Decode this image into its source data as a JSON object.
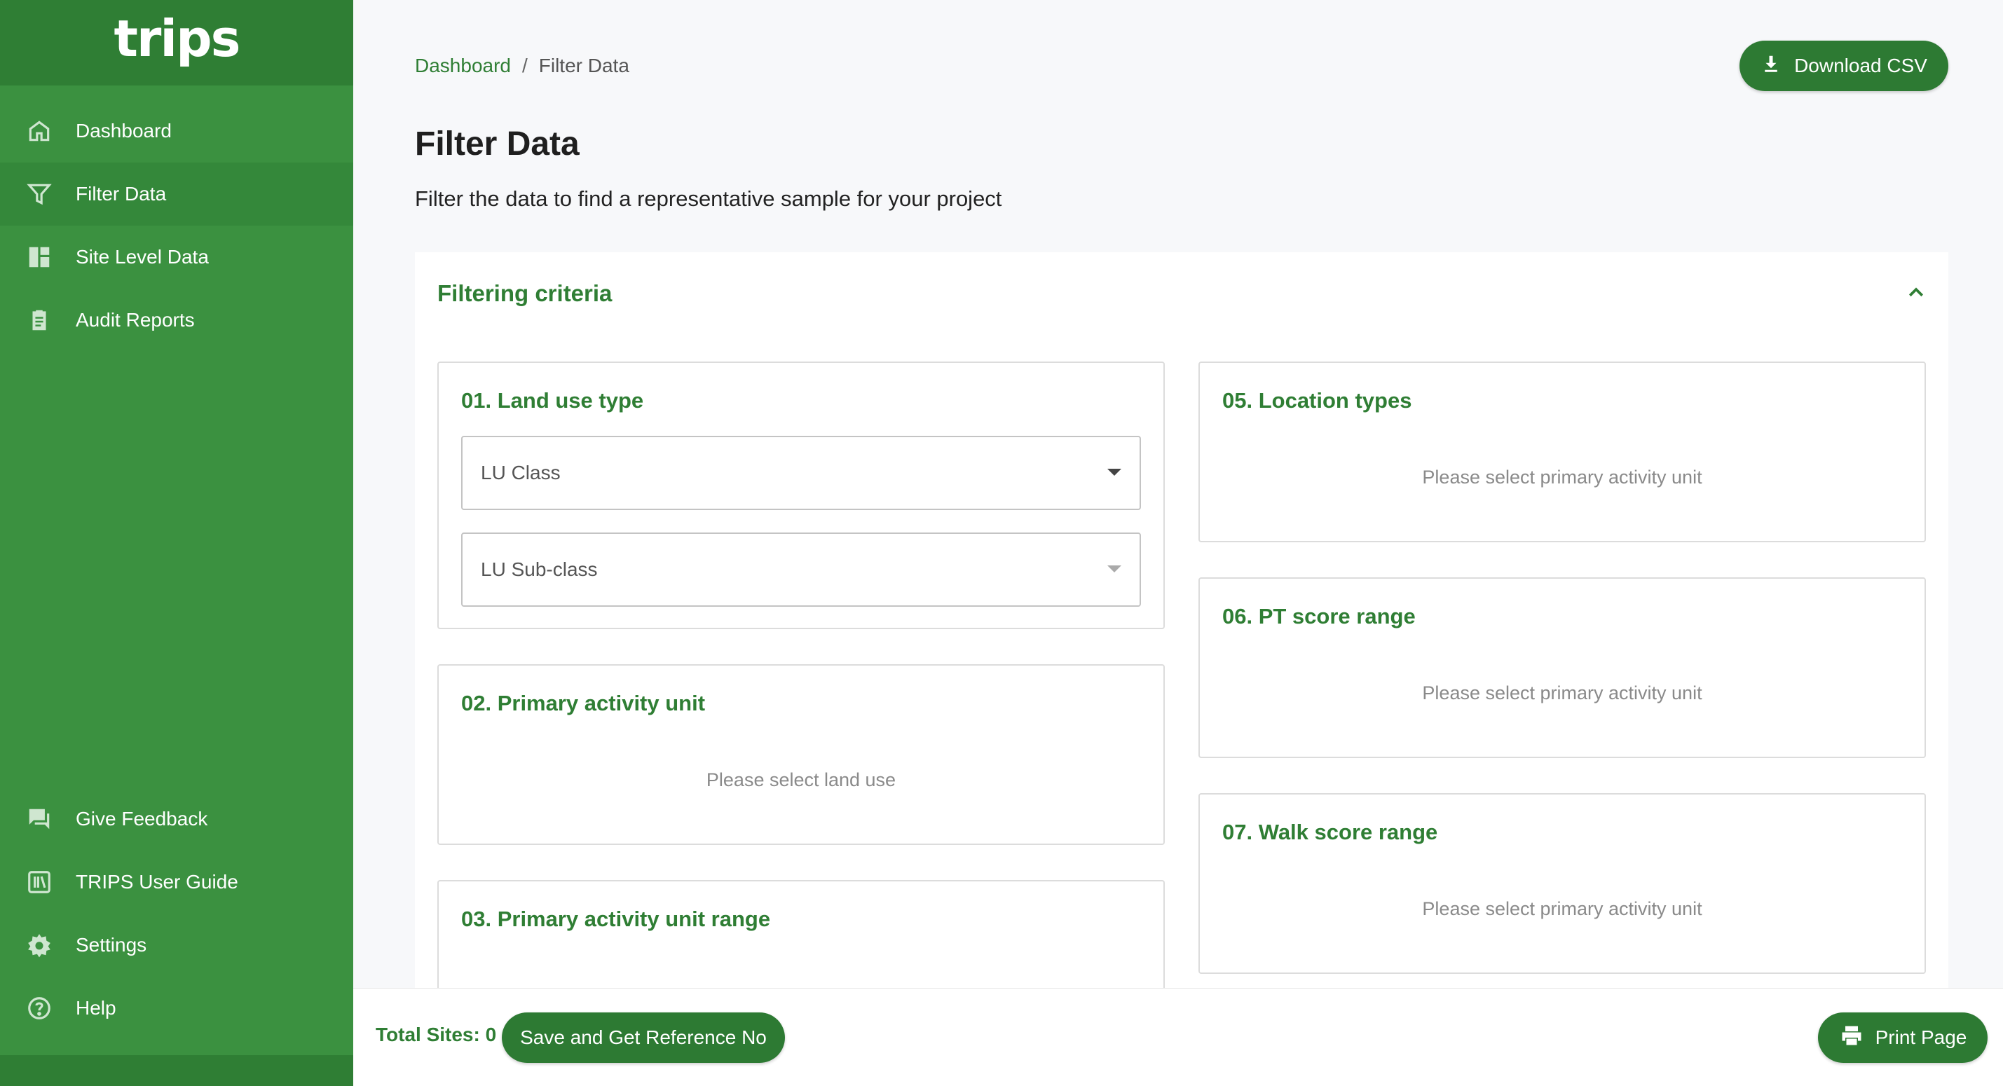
{
  "app": {
    "logo": "trips"
  },
  "sidebar": {
    "items": [
      {
        "label": "Dashboard",
        "icon": "home-icon"
      },
      {
        "label": "Filter Data",
        "icon": "filter-icon",
        "active": true
      },
      {
        "label": "Site Level Data",
        "icon": "dashboard-grid-icon"
      },
      {
        "label": "Audit Reports",
        "icon": "clipboard-icon"
      }
    ],
    "bottom_items": [
      {
        "label": "Give Feedback",
        "icon": "feedback-icon"
      },
      {
        "label": "TRIPS User Guide",
        "icon": "library-icon"
      },
      {
        "label": "Settings",
        "icon": "gear-icon"
      },
      {
        "label": "Help",
        "icon": "help-icon"
      }
    ]
  },
  "breadcrumb": {
    "home": "Dashboard",
    "separator": "/",
    "current": "Filter Data"
  },
  "header": {
    "download_label": "Download CSV",
    "title": "Filter Data",
    "subtitle": "Filter the data to find a representative sample for your project"
  },
  "panel": {
    "title": "Filtering criteria",
    "cards": {
      "land_use": {
        "title": "01. Land use type",
        "class_placeholder": "LU Class",
        "subclass_placeholder": "LU Sub-class"
      },
      "primary_activity": {
        "title": "02. Primary activity unit",
        "message": "Please select land use"
      },
      "primary_activity_range": {
        "title": "03. Primary activity unit range"
      },
      "location_types": {
        "title": "05. Location types",
        "message": "Please select primary activity unit"
      },
      "pt_score": {
        "title": "06. PT score range",
        "message": "Please select primary activity unit"
      },
      "walk_score": {
        "title": "07. Walk score range",
        "message": "Please select primary activity unit"
      }
    }
  },
  "footer": {
    "total_sites": "Total Sites: 0",
    "save_label": "Save and Get Reference No",
    "print_label": "Print Page"
  },
  "colors": {
    "brand_green": "#3b9140",
    "dark_green": "#2d7a33",
    "text_green": "#2f7e34"
  }
}
